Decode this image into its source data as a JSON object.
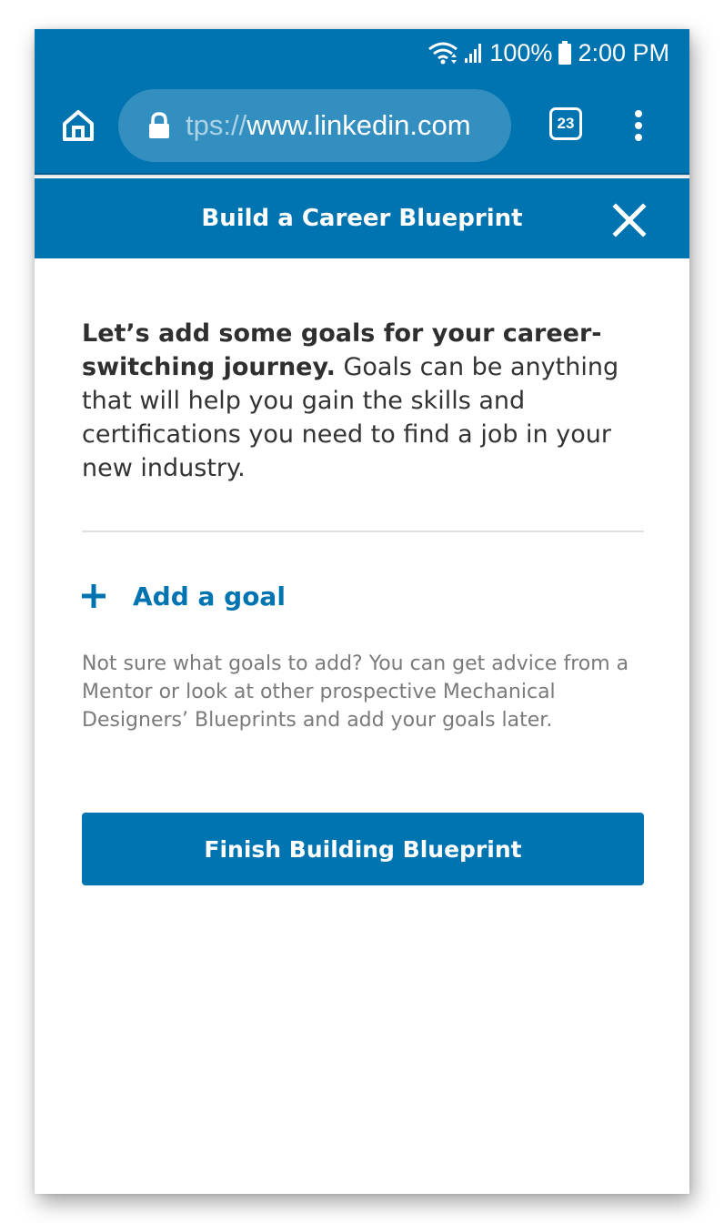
{
  "status_bar": {
    "battery": "100%",
    "time": "2:00 PM",
    "icons": [
      "wifi-icon",
      "signal-icon",
      "battery-icon"
    ]
  },
  "browser": {
    "url_scheme": "tps://",
    "url_host": "www.linkedin.com",
    "tab_count": "23",
    "icons": [
      "home-icon",
      "lock-icon",
      "tabs-icon",
      "overflow-menu-icon"
    ]
  },
  "header": {
    "title": "Build a Career Blueprint",
    "close_icon": "close-icon"
  },
  "main": {
    "intro_bold": "Let’s add some goals for your career-switching journey.",
    "intro_rest": " Goals can be anything that will help you gain the skills and certifications you need to find a job in your new industry.",
    "add_goal_label": "Add a goal",
    "add_goal_icon": "plus-icon",
    "advice": "Not sure what goals to add? You can get advice from a Mentor or look at other prospective Mechanical Designers’ Blueprints and add your goals later.",
    "finish_label": "Finish Building Blueprint"
  },
  "colors": {
    "brand": "#0073b1",
    "text": "#333333",
    "muted_text": "#7a7a7a",
    "divider": "#e0e0e0"
  }
}
